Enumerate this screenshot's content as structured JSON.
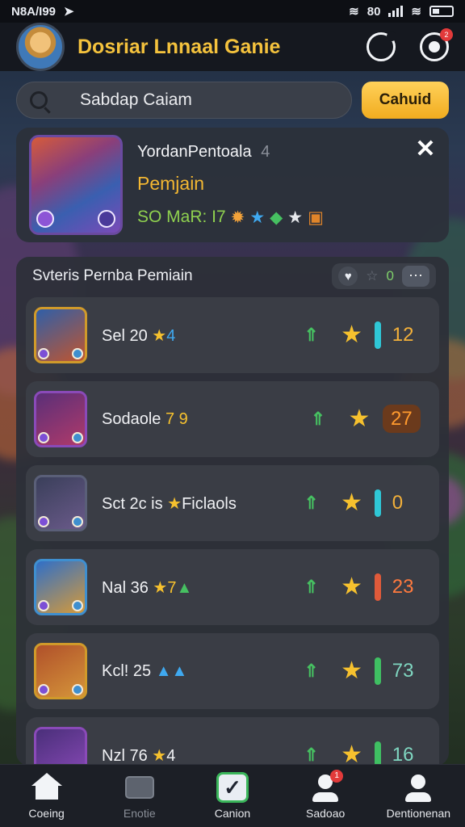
{
  "status_bar": {
    "left_text": "N8A/I99",
    "right_text": "80"
  },
  "header": {
    "title": "Dosriar Lnnaal Ganie",
    "notification_count": "2"
  },
  "search": {
    "value": "Sabdap Caiam",
    "button_label": "Cahuid"
  },
  "featured": {
    "name": "YordanPentoala",
    "name_suffix": "4",
    "role": "Pemjain",
    "stats_text": "SO MaR: I7",
    "close_label": "✕"
  },
  "leaderboard": {
    "title": "Svteris Pernba Pemiain",
    "tool_count": "0",
    "more_label": "···",
    "rows": [
      {
        "name": "Sel 20",
        "tag": "4",
        "score": "12",
        "bar_color": "#2fc7d6",
        "score_color": "#f2b03a",
        "avatar_colors": [
          "#2f5fa8",
          "#c0552f"
        ]
      },
      {
        "name": "Sodaole",
        "tag": "7 9",
        "score": "27",
        "bar_color": "#c0662a",
        "score_color": "#ff9a2e",
        "avatar_colors": [
          "#5a2f78",
          "#b03a6a"
        ]
      },
      {
        "name": "Sct 2c is",
        "tag": "Ficlaols",
        "score": "0",
        "bar_color": "#2fc7d6",
        "score_color": "#f2b03a",
        "avatar_colors": [
          "#3a3f5a",
          "#6a5a8a"
        ]
      },
      {
        "name": "Nal 36",
        "tag": "7",
        "score": "23",
        "bar_color": "#e05a3a",
        "score_color": "#ff7a3e",
        "avatar_colors": [
          "#2f6fc8",
          "#d59a3a"
        ]
      },
      {
        "name": "Kcl! 25",
        "tag": "",
        "score": "73",
        "bar_color": "#3fbf62",
        "score_color": "#7fd6c0",
        "avatar_colors": [
          "#b0502a",
          "#d5953a"
        ]
      },
      {
        "name": "Nzl 76",
        "tag": "4",
        "score": "16",
        "bar_color": "#3fbf62",
        "score_color": "#7fd6c0",
        "avatar_colors": [
          "#4a2f7a",
          "#8a4ab8"
        ]
      }
    ]
  },
  "bottom_nav": {
    "items": [
      {
        "label": "Coeing",
        "icon": "home-icon"
      },
      {
        "label": "Enotie",
        "icon": "chest-icon"
      },
      {
        "label": "Canion",
        "icon": "check-icon"
      },
      {
        "label": "Sadoao",
        "icon": "profile-icon",
        "badge": "1"
      },
      {
        "label": "Dentionenan",
        "icon": "account-icon"
      }
    ]
  },
  "colors": {
    "accent": "#f4c23d",
    "positive": "#46c061"
  }
}
